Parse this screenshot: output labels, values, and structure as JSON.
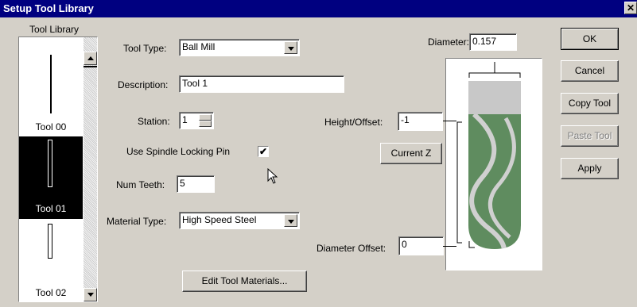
{
  "window": {
    "title": "Setup Tool Library",
    "close_glyph": "✕"
  },
  "tool_library": {
    "label": "Tool Library",
    "items": [
      {
        "name": "Tool 00",
        "selected": false
      },
      {
        "name": "Tool 01",
        "selected": true
      },
      {
        "name": "Tool 02",
        "selected": false
      }
    ]
  },
  "form": {
    "tool_type": {
      "label": "Tool Type:",
      "value": "Ball Mill"
    },
    "description": {
      "label": "Description:",
      "value": "Tool 1"
    },
    "station": {
      "label": "Station:",
      "value": "1"
    },
    "spindle_lock": {
      "label": "Use Spindle Locking Pin",
      "checked": true,
      "check_glyph": "✔"
    },
    "num_teeth": {
      "label": "Num Teeth:",
      "value": "5"
    },
    "material_type": {
      "label": "Material Type:",
      "value": "High Speed Steel"
    },
    "edit_materials_label": "Edit Tool Materials..."
  },
  "dimensions": {
    "diameter": {
      "label": "Diameter:",
      "value": "0.157"
    },
    "height_offset": {
      "label": "Height/Offset:",
      "value": "-1"
    },
    "current_z_label": "Current Z",
    "diameter_offset": {
      "label": "Diameter Offset:",
      "value": "0"
    }
  },
  "buttons": {
    "ok": "OK",
    "cancel": "Cancel",
    "copy_tool": "Copy Tool",
    "paste_tool": "Paste Tool",
    "apply": "Apply"
  },
  "colors": {
    "titlebar": "#000080",
    "flute_green": "#5f8c5f",
    "dialog_bg": "#d4d0c8"
  }
}
